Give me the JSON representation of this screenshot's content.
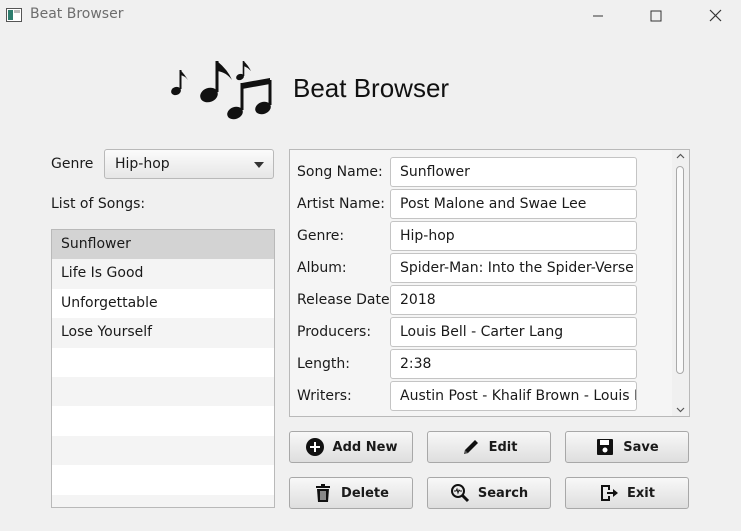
{
  "window": {
    "title": "Beat Browser"
  },
  "header": {
    "title": "Beat Browser",
    "logo_icon": "music-notes-icon"
  },
  "genre": {
    "label": "Genre",
    "selected": "Hip-hop"
  },
  "songs": {
    "label": "List of Songs:",
    "items": [
      "Sunflower",
      "Life Is Good",
      "Unforgettable",
      "Lose Yourself"
    ],
    "selected_index": 0
  },
  "details": {
    "fields": [
      {
        "label": "Song Name:",
        "value": "Sunflower"
      },
      {
        "label": "Artist Name:",
        "value": "Post Malone and Swae Lee"
      },
      {
        "label": "Genre:",
        "value": "Hip-hop"
      },
      {
        "label": "Album:",
        "value": "Spider-Man: Into the Spider-Verse"
      },
      {
        "label": "Release Date:",
        "value": "2018"
      },
      {
        "label": "Producers:",
        "value": "Louis Bell - Carter Lang"
      },
      {
        "label": "Length:",
        "value": "2:38"
      },
      {
        "label": "Writers:",
        "value": "Austin Post - Khalif Brown - Louis Bell"
      }
    ]
  },
  "buttons": {
    "add_new": "Add New",
    "edit": "Edit",
    "save": "Save",
    "delete": "Delete",
    "search": "Search",
    "exit": "Exit"
  }
}
